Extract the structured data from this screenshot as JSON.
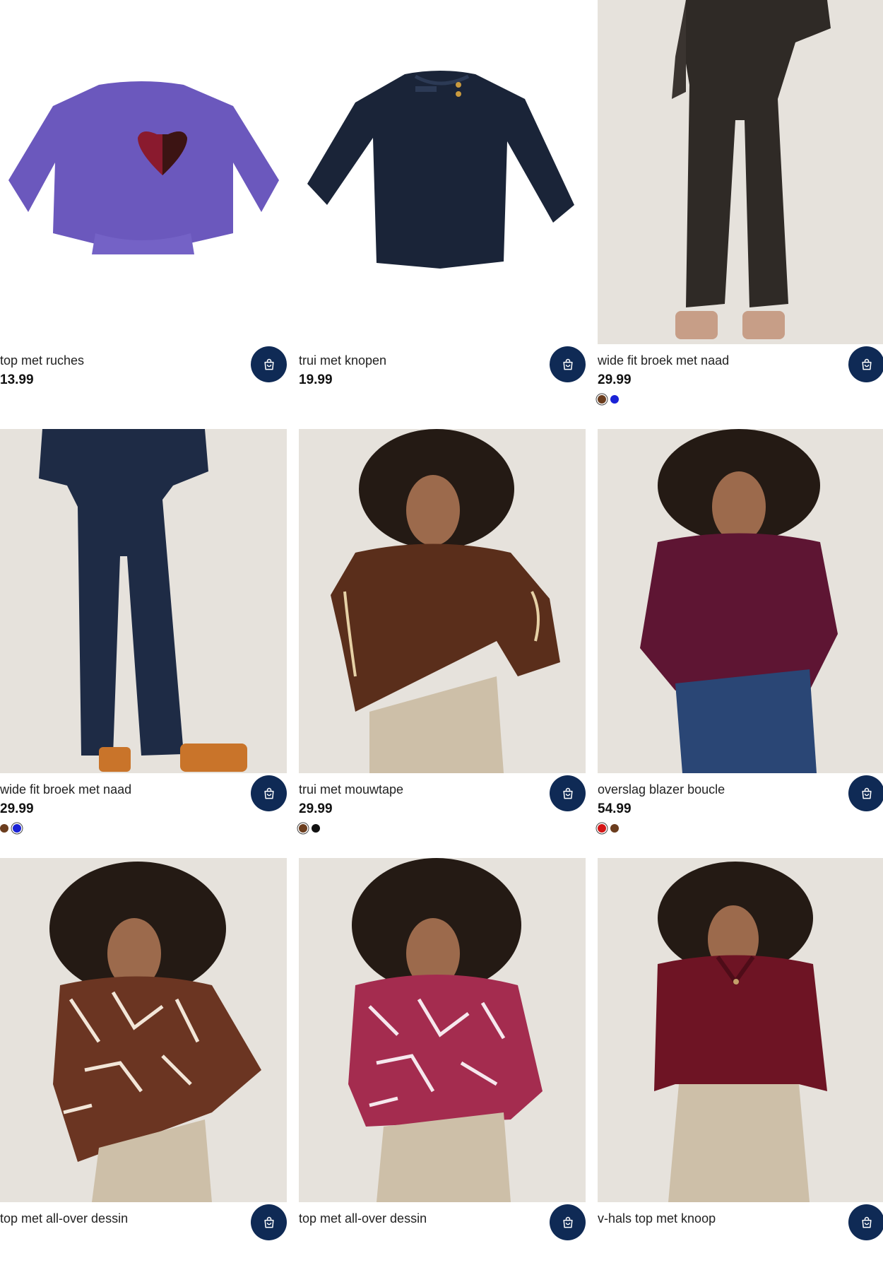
{
  "products": [
    {
      "name": "top met ruches",
      "price": "13.99",
      "swatches": [],
      "photo": "purple ruffle top with heart"
    },
    {
      "name": "trui met knopen",
      "price": "19.99",
      "swatches": [],
      "photo": "navy knit sweater with buttons"
    },
    {
      "name": "wide fit broek met naad",
      "price": "29.99",
      "swatches": [
        {
          "color": "#6b3d1e",
          "selected": true
        },
        {
          "color": "#1a22d6",
          "selected": false
        }
      ],
      "photo": "brown wide trousers"
    },
    {
      "name": "wide fit broek met naad",
      "price": "29.99",
      "swatches": [
        {
          "color": "#6b3d1e",
          "selected": false
        },
        {
          "color": "#1a22d6",
          "selected": true
        }
      ],
      "photo": "navy wide trousers"
    },
    {
      "name": "trui met mouwtape",
      "price": "29.99",
      "swatches": [
        {
          "color": "#6b3d1e",
          "selected": true
        },
        {
          "color": "#111111",
          "selected": false
        }
      ],
      "photo": "brown sweater with embroidered sleeves"
    },
    {
      "name": "overslag blazer boucle",
      "price": "54.99",
      "swatches": [
        {
          "color": "#d41515",
          "selected": true
        },
        {
          "color": "#6b3d1e",
          "selected": false
        }
      ],
      "photo": "burgundy boucle wrap blazer"
    },
    {
      "name": "top met all-over dessin",
      "price": "",
      "swatches": [],
      "photo": "brown graphic print top"
    },
    {
      "name": "top met all-over dessin",
      "price": "",
      "swatches": [],
      "photo": "pink graphic print top"
    },
    {
      "name": "v-hals top met knoop",
      "price": "",
      "swatches": [],
      "photo": "burgundy v-neck top"
    }
  ],
  "icons": {
    "cart": "shopping-bag-icon"
  },
  "colors": {
    "cart_button": "#0f2a55",
    "photo_bg": "#e6e2dc"
  }
}
